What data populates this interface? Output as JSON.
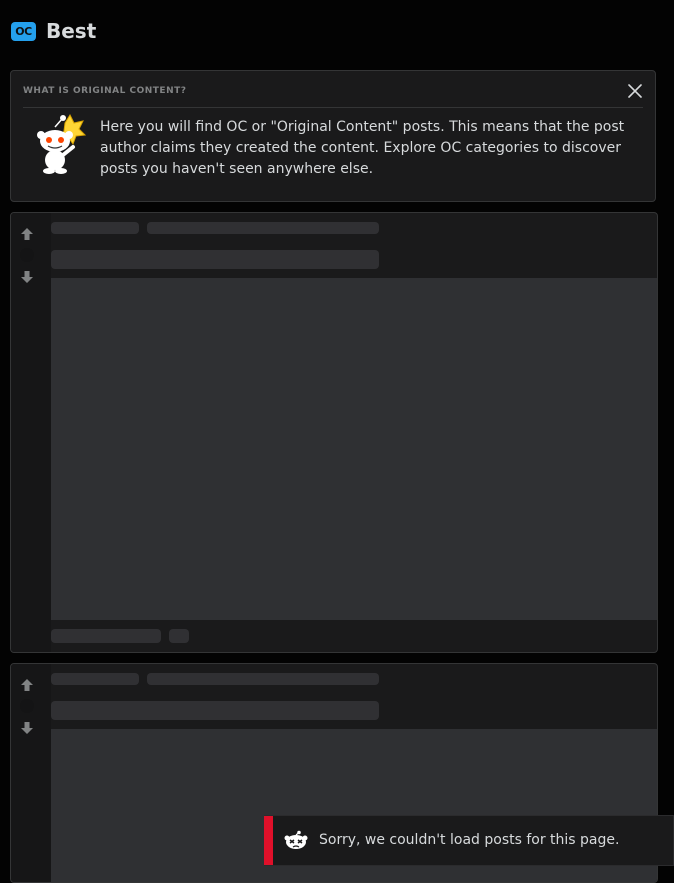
{
  "header": {
    "badge": "OC",
    "title": "Best"
  },
  "info_card": {
    "label": "WHAT IS ORIGINAL CONTENT?",
    "text": "Here you will find OC or \"Original Content\" posts. This means that the post author claims they created the content. Explore OC categories to discover posts you haven't seen anywhere else.",
    "close_icon": "close-icon",
    "mascot_icon": "snoo-mascot-icon"
  },
  "posts": [
    {
      "state": "loading",
      "upvote_icon": "arrow-up-icon",
      "downvote_icon": "arrow-down-icon"
    },
    {
      "state": "loading",
      "upvote_icon": "arrow-up-icon",
      "downvote_icon": "arrow-down-icon"
    }
  ],
  "toast": {
    "message": "Sorry, we couldn't load posts for this page.",
    "icon": "snoo-error-icon",
    "accent_color": "#e0102a"
  },
  "colors": {
    "background": "#030303",
    "card": "#1a1a1b",
    "border": "#343536",
    "oc_badge": "#24a0ed",
    "text": "#d7dadc"
  }
}
